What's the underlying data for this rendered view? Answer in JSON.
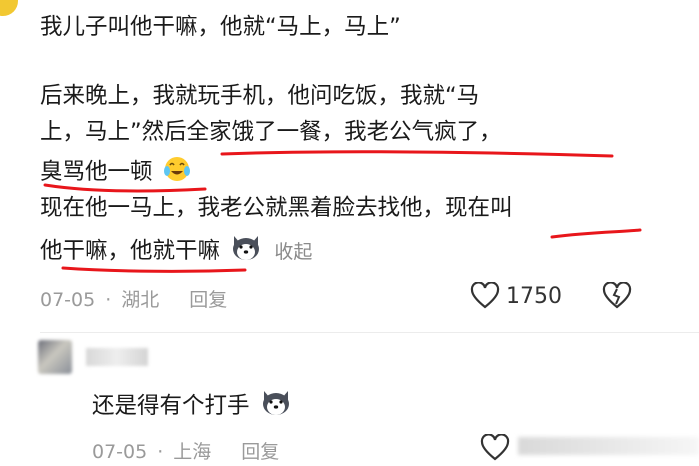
{
  "comment": {
    "line1": "我儿子叫他干嘛，他就“马上，马上”",
    "line2": "后来晚上，我就玩手机，他问吃饭，我就“马",
    "line3": "上，马上”然后全家饿了一餐，我老公气疯了，",
    "line4": "臭骂他一顿",
    "line5": "现在他一马上，我老公就黑着脸去找他，现在叫",
    "line6": "他干嘛，他就干嘛",
    "fold": "收起",
    "date": "07-05",
    "location": "湖北",
    "reply": "回复",
    "likes": "1750"
  },
  "reply_comment": {
    "text": "还是得有个打手",
    "date": "07-05",
    "location": "上海",
    "reply": "回复"
  },
  "icons": {
    "emoji_crying": "crying-laughing-emoji",
    "emoji_dog": "husky-dog-emoji",
    "heart": "heart-outline-icon",
    "dislike": "broken-heart-icon"
  },
  "colors": {
    "underline": "#e8161b",
    "meta": "#9a9a9a"
  }
}
